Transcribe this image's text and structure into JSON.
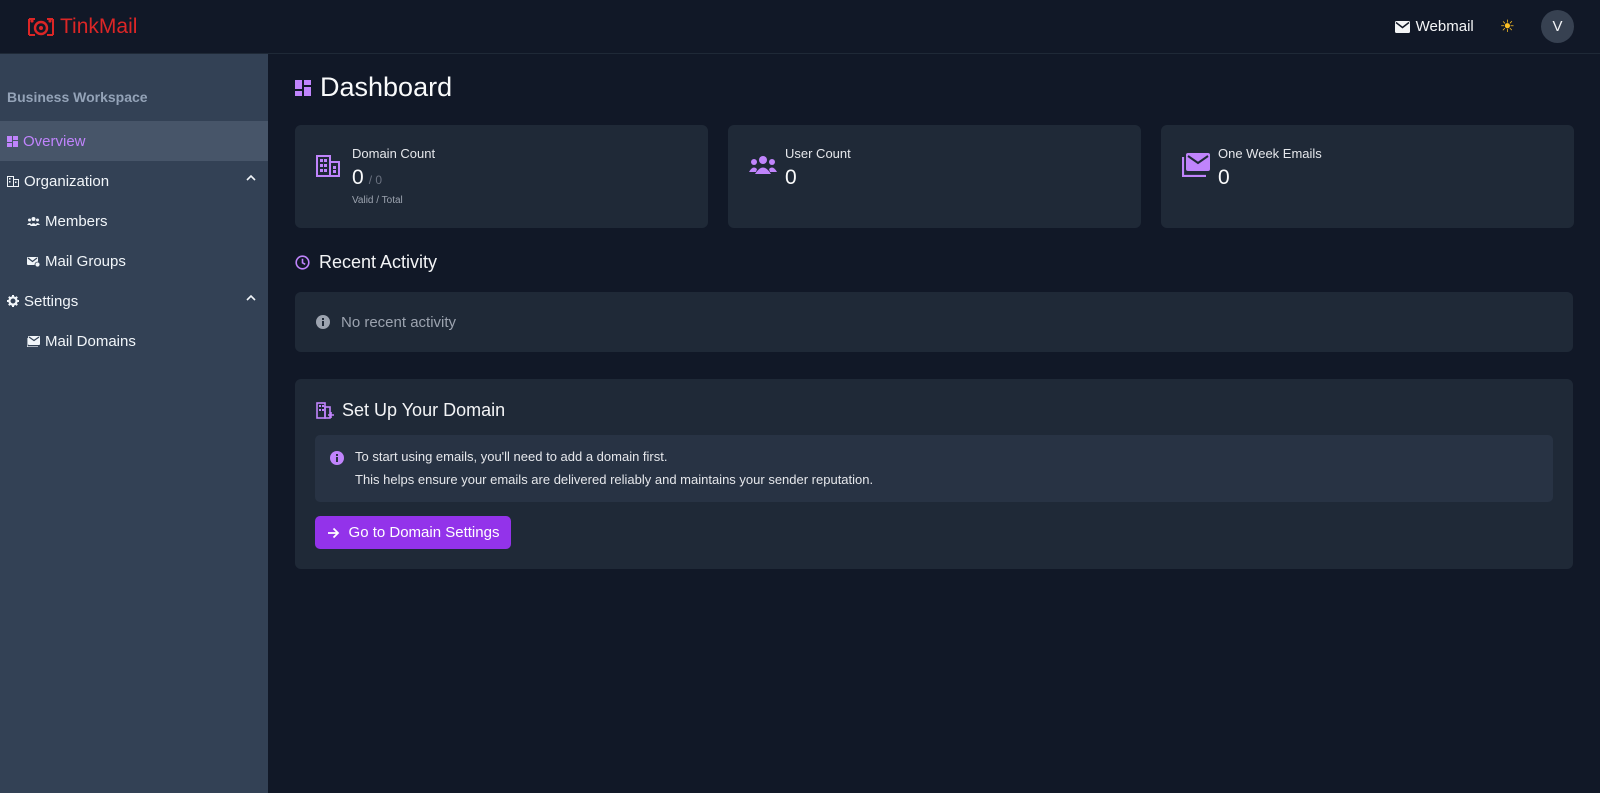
{
  "app": {
    "name": "TinkMail"
  },
  "header": {
    "webmail_label": "Webmail",
    "avatar_initial": "V"
  },
  "sidebar": {
    "workspace": "Business Workspace",
    "items": [
      {
        "label": "Overview",
        "icon": "dashboard-icon",
        "active": true
      },
      {
        "label": "Organization",
        "icon": "building-icon",
        "expanded": true
      },
      {
        "label": "Members",
        "icon": "people-icon"
      },
      {
        "label": "Mail Groups",
        "icon": "mail-group-icon"
      },
      {
        "label": "Settings",
        "icon": "gear-icon",
        "expanded": true
      },
      {
        "label": "Mail Domains",
        "icon": "mail-domain-icon"
      }
    ]
  },
  "main": {
    "title": "Dashboard",
    "stats": [
      {
        "label": "Domain Count",
        "value": "0",
        "total": "/ 0",
        "sub": "Valid / Total",
        "icon": "building-icon"
      },
      {
        "label": "User Count",
        "value": "0",
        "icon": "people-icon"
      },
      {
        "label": "One Week Emails",
        "value": "0",
        "icon": "mail-stack-icon"
      }
    ],
    "recent_activity": {
      "title": "Recent Activity",
      "empty_text": "No recent activity"
    },
    "setup": {
      "title": "Set Up Your Domain",
      "info_line1": "To start using emails, you'll need to add a domain first.",
      "info_line2": "This helps ensure your emails are delivered reliably and maintains your sender reputation.",
      "button_label": "Go to Domain Settings"
    }
  },
  "colors": {
    "accent": "#c084fc",
    "button": "#9333ea",
    "brand": "#dc2626",
    "sidebar": "#334155",
    "background": "#111827",
    "card": "#1f2937"
  }
}
